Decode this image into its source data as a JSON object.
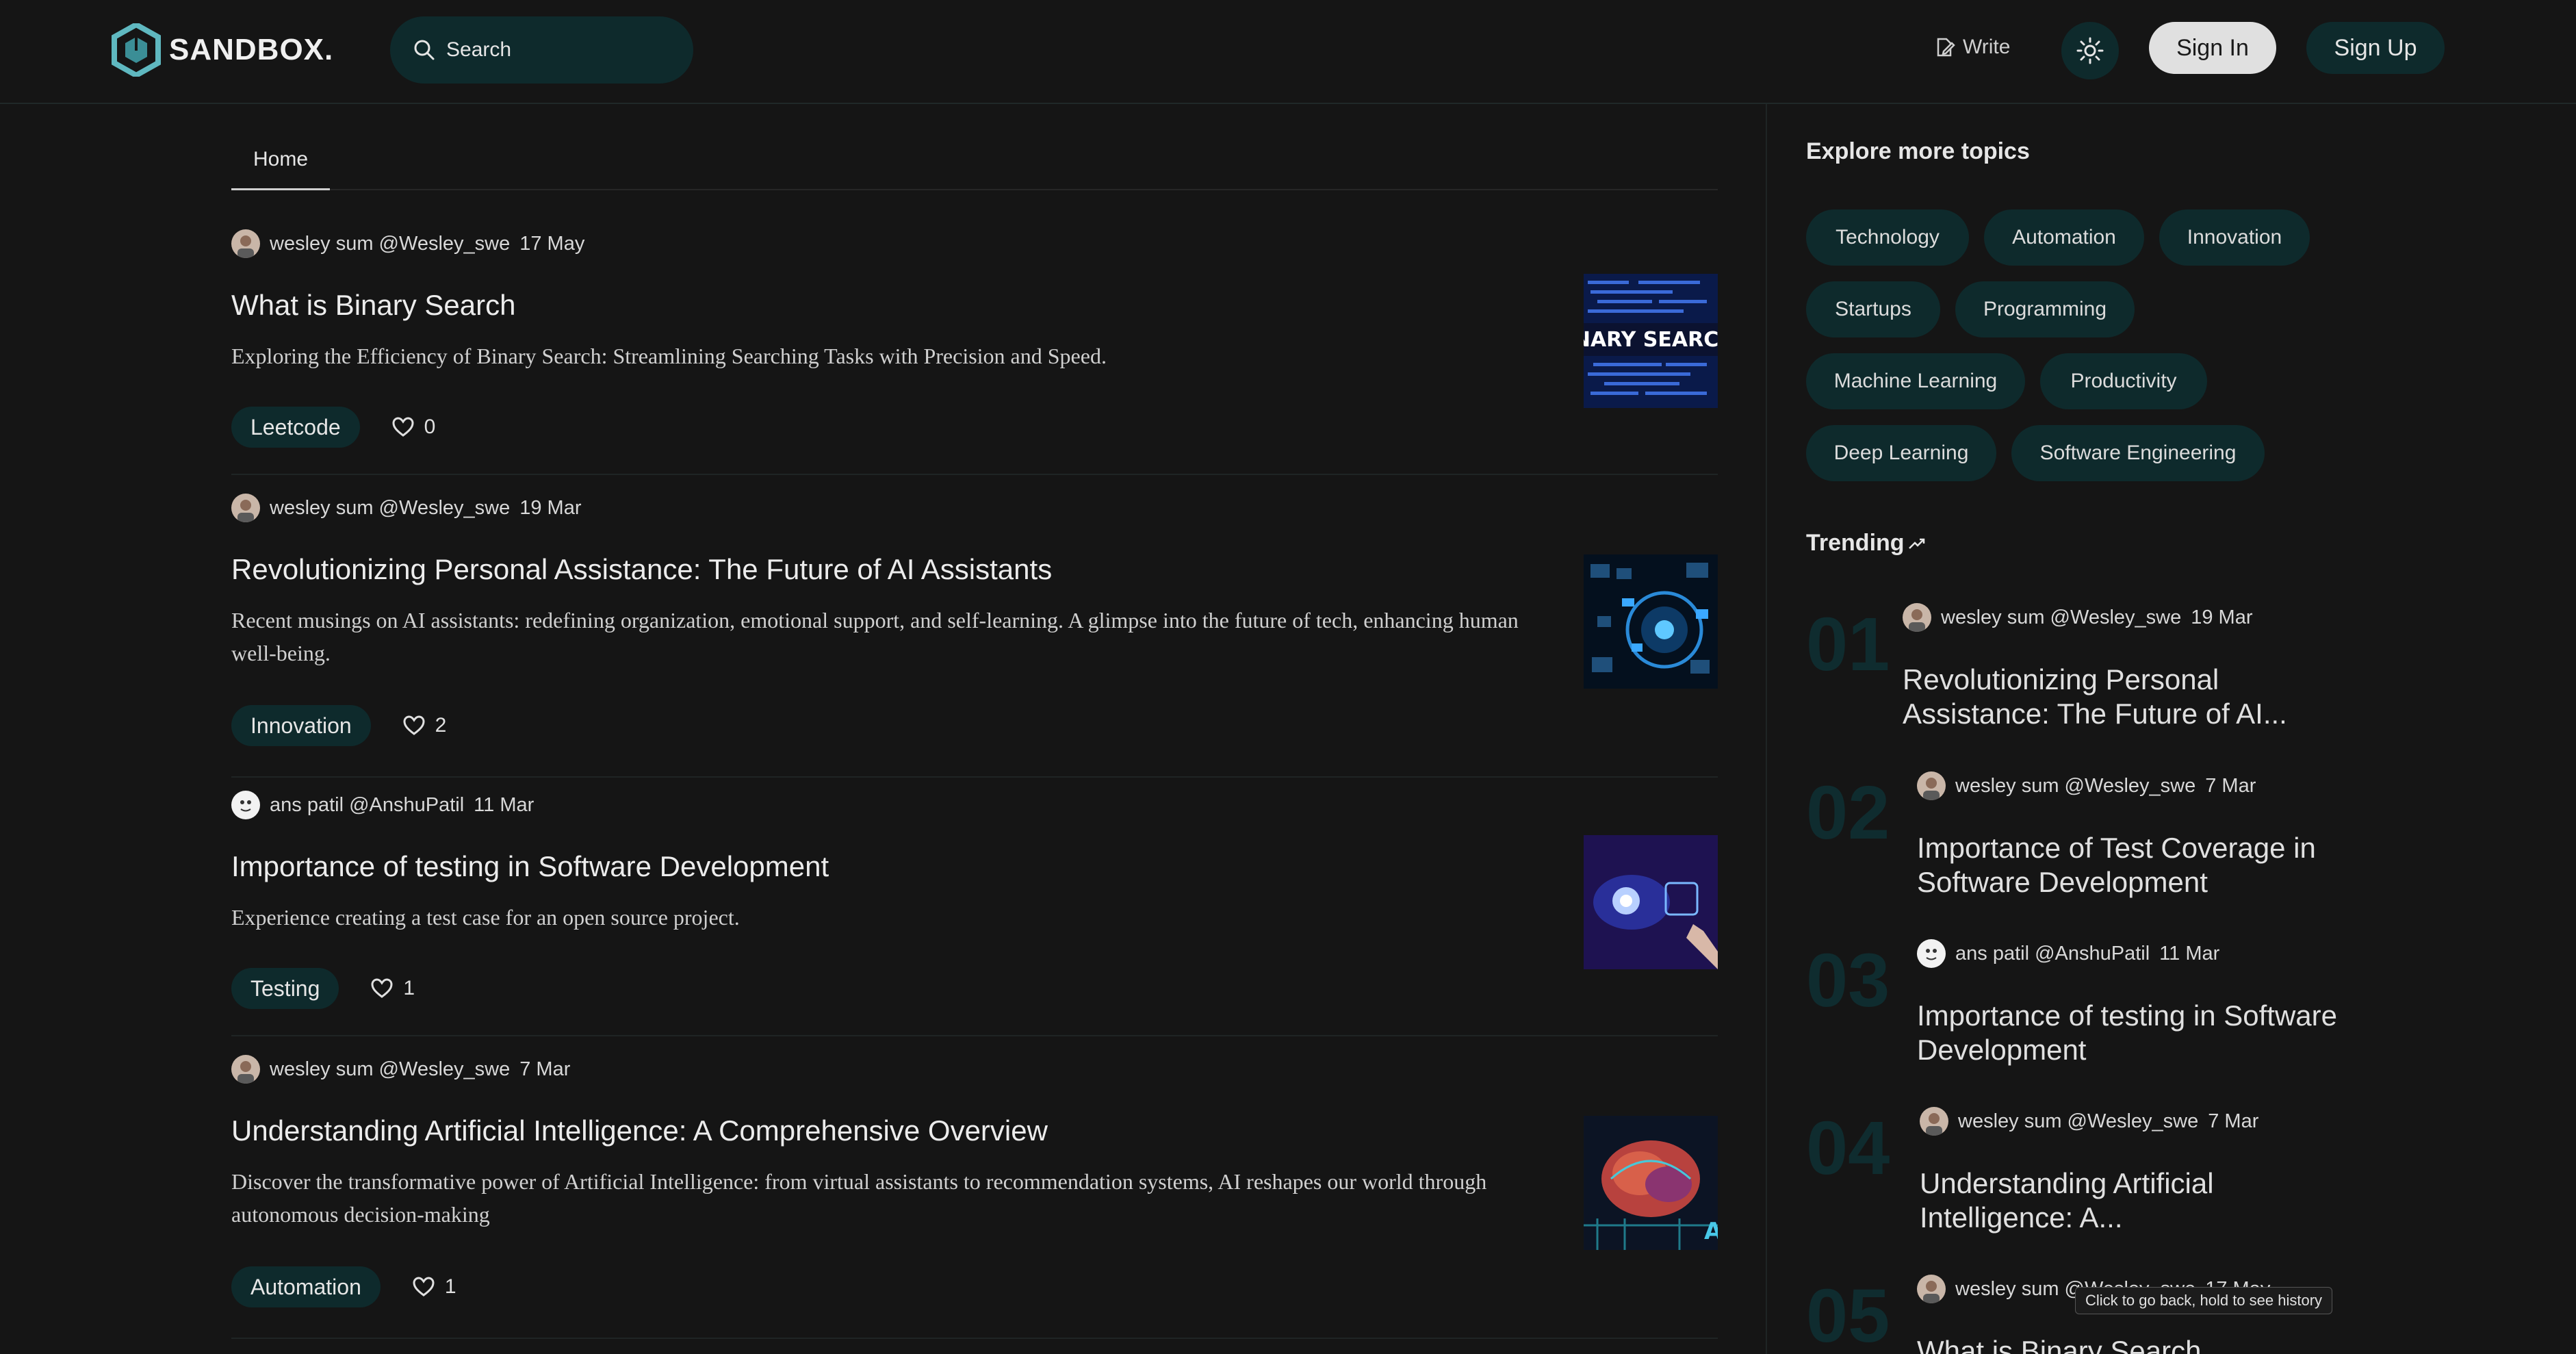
{
  "header": {
    "logo_text": "SANDBOX.",
    "search_placeholder": "Search",
    "write_label": "Write",
    "signin_label": "Sign In",
    "signup_label": "Sign Up"
  },
  "tabs": [
    {
      "label": "Home"
    }
  ],
  "posts": [
    {
      "author": "wesley sum @Wesley_swe",
      "date": "17 May",
      "title": "What is Binary Search",
      "desc": "Exploring the Efficiency of Binary Search: Streamlining Searching Tasks with Precision and Speed.",
      "tag": "Leetcode",
      "likes": "0",
      "thumb_text": "INARY SEARCH"
    },
    {
      "author": "wesley sum @Wesley_swe",
      "date": "19 Mar",
      "title": "Revolutionizing Personal Assistance: The Future of AI Assistants",
      "desc": "Recent musings on AI assistants: redefining organization, emotional support, and self-learning. A glimpse into the future of tech, enhancing human well-being.",
      "tag": "Innovation",
      "likes": "2"
    },
    {
      "author": "ans patil @AnshuPatil",
      "date": "11 Mar",
      "title": "Importance of testing in Software Development",
      "desc": "Experience creating a test case for an open source project.",
      "tag": "Testing",
      "likes": "1"
    },
    {
      "author": "wesley sum @Wesley_swe",
      "date": "7 Mar",
      "title": "Understanding Artificial Intelligence: A Comprehensive Overview",
      "desc": "Discover the transformative power of Artificial Intelligence: from virtual assistants to recommendation systems, AI reshapes our world through autonomous decision-making",
      "tag": "Automation",
      "likes": "1"
    }
  ],
  "sidebar": {
    "explore_title": "Explore more topics",
    "topics": [
      "Technology",
      "Automation",
      "Innovation",
      "Startups",
      "Programming",
      "Machine Learning",
      "Productivity",
      "Deep Learning",
      "Software Engineering"
    ],
    "trending_title": "Trending",
    "trending": [
      {
        "num": "01",
        "author": "wesley sum @Wesley_swe",
        "date": "19 Mar",
        "title": "Revolutionizing Personal Assistance: The Future of AI..."
      },
      {
        "num": "02",
        "author": "wesley sum @Wesley_swe",
        "date": "7 Mar",
        "title": "Importance of Test Coverage in Software Development"
      },
      {
        "num": "03",
        "author": "ans patil @AnshuPatil",
        "date": "11 Mar",
        "title": "Importance of testing in Software Development"
      },
      {
        "num": "04",
        "author": "wesley sum @Wesley_swe",
        "date": "7 Mar",
        "title": "Understanding Artificial Intelligence: A..."
      },
      {
        "num": "05",
        "author": "wesley sum @Wesley_swe",
        "date": "17 May",
        "title": "What is Binary Search"
      }
    ]
  },
  "tooltip": "Click to go back, hold to see history",
  "icons": {
    "logo": "hexagon-cube-logo",
    "search": "search-icon",
    "write": "edit-icon",
    "theme": "sun-icon",
    "like": "heart-icon",
    "trending": "trend-up-icon"
  },
  "colors": {
    "background": "#151515",
    "accent_dark_teal": "#0e2a2c",
    "logo_teal": "#5fb8c0"
  }
}
